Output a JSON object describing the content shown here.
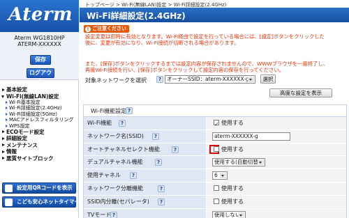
{
  "sidebar": {
    "logo": "Aterm",
    "model": "Aterm WG1810HP",
    "device_name": "ATERM-XXXXXX",
    "save_label": "保存",
    "logout_label": "ログアウト",
    "menu": [
      {
        "label": "基本設定",
        "level": 0,
        "state": "collapsed"
      },
      {
        "label": "Wi-Fi(無線LAN)設定",
        "level": 0,
        "state": "expanded"
      },
      {
        "label": "Wi-Fi基本設定",
        "level": 1
      },
      {
        "label": "Wi-Fi詳細設定(2.4GHz)",
        "level": 1
      },
      {
        "label": "Wi-Fi詳細設定(5GHz)",
        "level": 1
      },
      {
        "label": "MACアドレスフィルタリング",
        "level": 1
      },
      {
        "label": "WPS設定",
        "level": 1
      },
      {
        "label": "ECOモード設定",
        "level": 0,
        "state": "collapsed"
      },
      {
        "label": "詳細設定",
        "level": 0,
        "state": "collapsed"
      },
      {
        "label": "メンテナンス",
        "level": 0,
        "state": "collapsed"
      },
      {
        "label": "情報",
        "level": 0,
        "state": "collapsed"
      },
      {
        "label": "悪質サイトブロック",
        "level": 0,
        "state": "collapsed"
      }
    ],
    "qr_button_label": "設定用QRコードを表示",
    "timer_button_label": "こども安心ネットタイマー"
  },
  "main": {
    "breadcrumb": "トップページ > Wi-Fi(無線LAN)設定 > Wi-Fi詳細設定(2.4GHz)",
    "title": "Wi-Fi詳細設定(2.4GHz)",
    "caution_label": "ご注意ください",
    "warnings": [
      "設定変更は即時に有効となります。Wi-Fi経由で設定を行っている場合には、[設定]ボタンをクリックした",
      "後に、変更が有効になり、Wi-Fi接続が切断される場合があります。",
      "また、[保存]ボタンをクリックするまでは設定内容が保存されませんので、WWWブラウザを一度終了し、",
      "再度Wi-Fi接続を行い、[保存]ボタンをクリックして設定内容の保存を行ってください。"
    ],
    "target_label": "対象ネットワークを選択",
    "ssid_value": "オーナーSSID：aterm-XXXXXX-g",
    "select_button": "選択",
    "advanced_button": "高度な設定を表示",
    "section_title": "Wi-Fi機能設定",
    "rows": [
      {
        "label": "Wi-Fi機能",
        "type": "checkbox",
        "checked": true,
        "value": "使用する"
      },
      {
        "label": "ネットワーク名(SSID)",
        "type": "text",
        "value": "aterm-XXXXXX-g"
      },
      {
        "label": "オートチャネルセレクト機能",
        "type": "checkbox",
        "checked": false,
        "value": "使用する",
        "highlighted": true
      },
      {
        "label": "デュアルチャネル機能",
        "type": "select",
        "value": "使用する(自動切替)"
      },
      {
        "label": "使用チャネル",
        "type": "select",
        "value": "6"
      },
      {
        "label": "ネットワーク分離機能",
        "type": "checkbox",
        "checked": false,
        "value": "使用する"
      },
      {
        "label": "SSID内分離(セパレータ)",
        "type": "checkbox",
        "checked": false,
        "value": "使用する"
      },
      {
        "label": "TVモード",
        "type": "select",
        "value": "使用しない"
      }
    ],
    "colors": {
      "accent": "#1e5bb5",
      "warning": "#e03a10",
      "label_bg": "#dfe7f4"
    }
  }
}
